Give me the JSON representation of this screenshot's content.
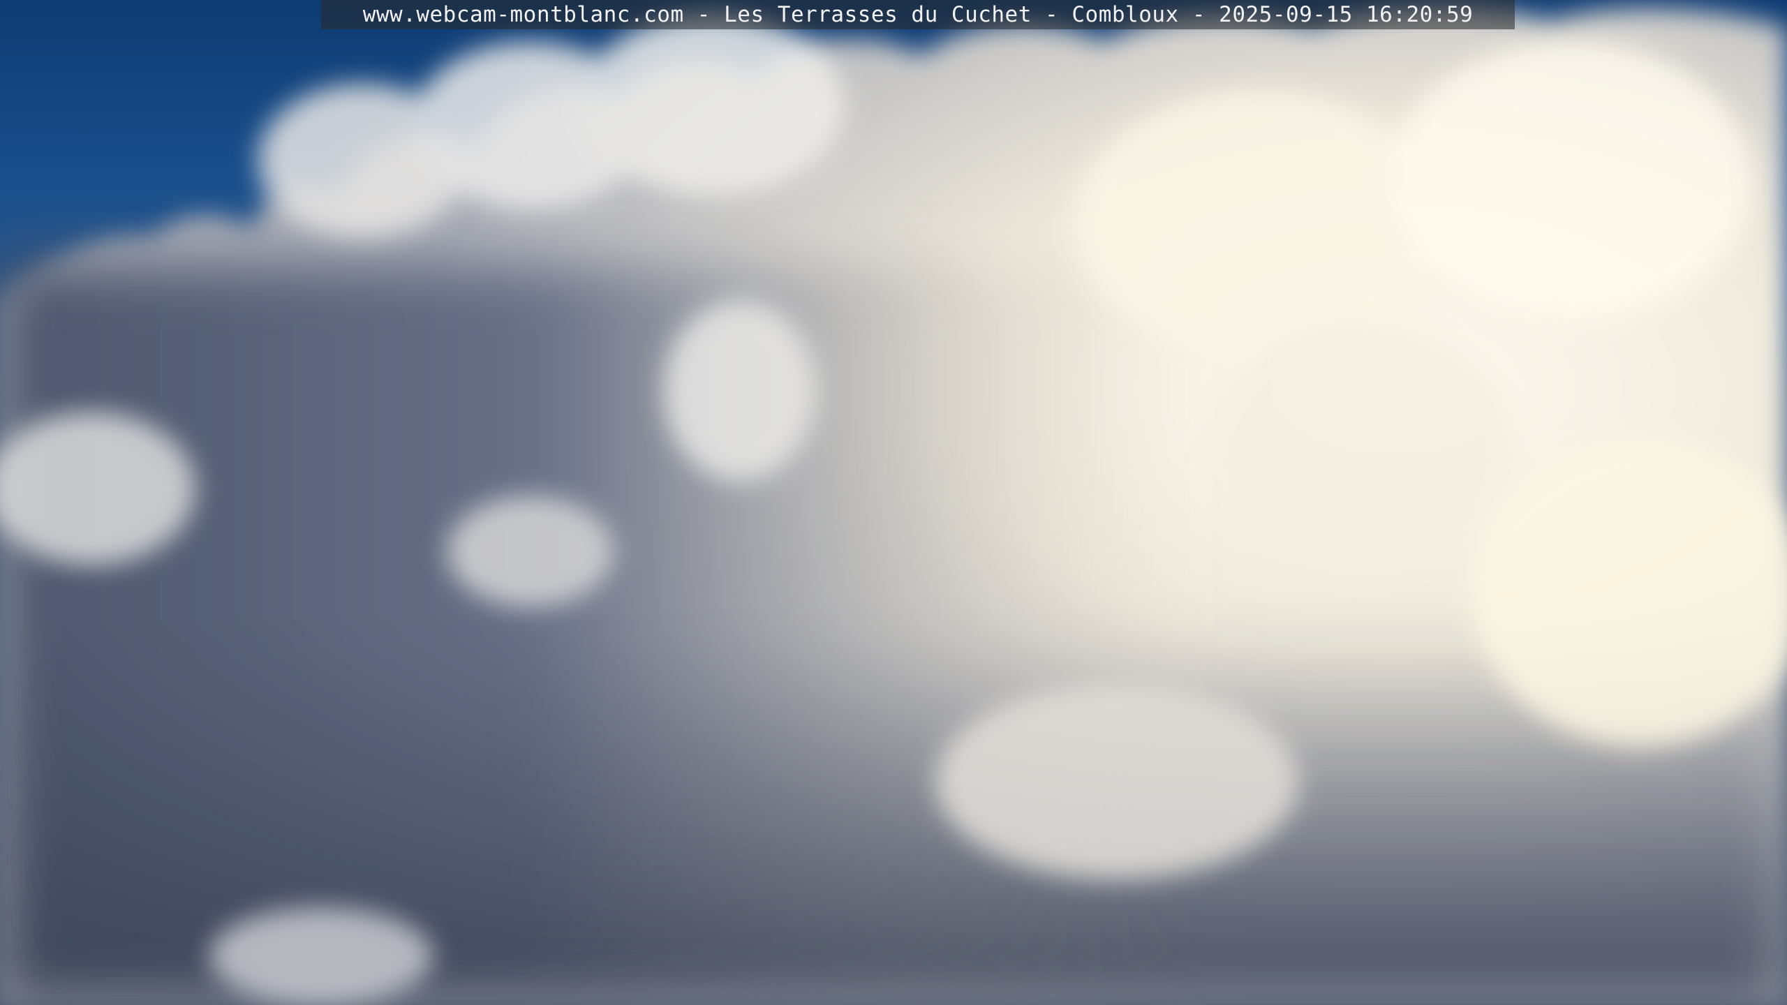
{
  "webcam": {
    "caption": "www.webcam-montblanc.com - Les Terrasses du Cuchet - Combloux - 2025-09-15 16:20:59"
  },
  "colors": {
    "sky_blue": "#1a4f8c",
    "cloud_bright": "#fbf6e6",
    "cloud_shadow": "#5c6275"
  }
}
